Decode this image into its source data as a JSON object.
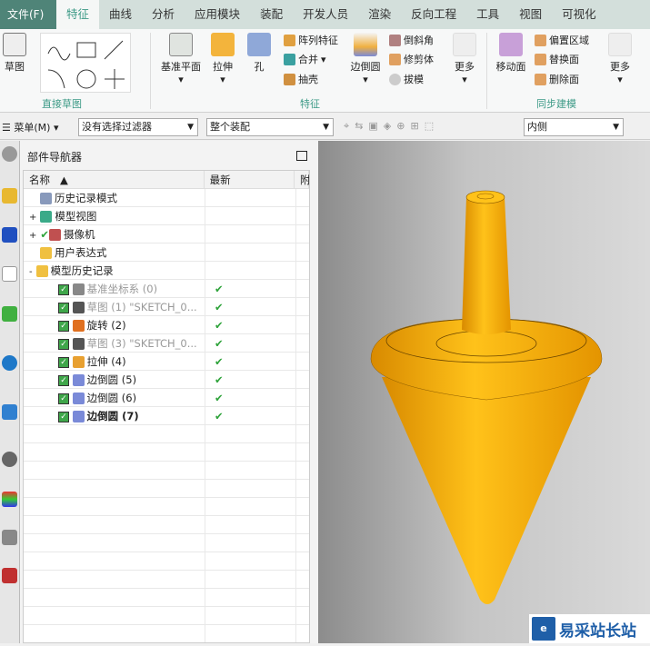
{
  "menubar": {
    "file": "文件(F)",
    "tabs": [
      "特征",
      "曲线",
      "分析",
      "应用模块",
      "装配",
      "开发人员",
      "渲染",
      "反向工程",
      "工具",
      "视图",
      "可视化"
    ],
    "active": "特征"
  },
  "ribbon": {
    "sketch": "草图",
    "direct_sketch_group": "直接草图",
    "datum_plane": "基准平面",
    "extrude": "拉伸",
    "hole": "孔",
    "pattern": "阵列特征",
    "unite": "合并",
    "shell": "抽壳",
    "edge_blend": "边倒圆",
    "chamfer": "倒斜角",
    "trim_body": "修剪体",
    "draft": "拔模",
    "more1": "更多",
    "feature_group": "特征",
    "move_face": "移动面",
    "offset_region": "偏置区域",
    "replace_face": "替换面",
    "delete_face": "删除面",
    "more2": "更多",
    "sync_group": "同步建模"
  },
  "toolbar": {
    "menu": "菜单(M)",
    "filter": "没有选择过滤器",
    "scope": "整个装配",
    "snap": "内侧"
  },
  "navigator": {
    "title": "部件导航器",
    "columns": [
      "名称",
      "最新",
      "附"
    ],
    "rows": [
      {
        "label": "历史记录模式",
        "icon": "clock-icon",
        "expander": "",
        "check": false,
        "latest": "",
        "style": "normal"
      },
      {
        "label": "模型视图",
        "icon": "model-view-icon",
        "expander": "+",
        "check": false,
        "latest": "",
        "style": "normal"
      },
      {
        "label": "摄像机",
        "icon": "camera-icon",
        "expander": "+",
        "check": false,
        "latest": "",
        "style": "normal",
        "green_tick": true
      },
      {
        "label": "用户表达式",
        "icon": "folder-icon",
        "expander": "",
        "check": false,
        "latest": "",
        "style": "normal"
      },
      {
        "label": "模型历史记录",
        "icon": "folder-open-icon",
        "expander": "-",
        "check": false,
        "latest": "",
        "style": "normal"
      },
      {
        "label": "基准坐标系 (0)",
        "icon": "datum-csys-icon",
        "check": true,
        "latest": "✔",
        "style": "gray"
      },
      {
        "label": "草图 (1) \"SKETCH_0...",
        "icon": "sketch-icon",
        "check": true,
        "latest": "✔",
        "style": "gray"
      },
      {
        "label": "旋转 (2)",
        "icon": "revolve-icon",
        "check": true,
        "latest": "✔",
        "style": "normal"
      },
      {
        "label": "草图 (3) \"SKETCH_0...",
        "icon": "sketch-icon",
        "check": true,
        "latest": "✔",
        "style": "gray"
      },
      {
        "label": "拉伸 (4)",
        "icon": "extrude-icon",
        "check": true,
        "latest": "✔",
        "style": "normal"
      },
      {
        "label": "边倒圆 (5)",
        "icon": "edge-blend-icon",
        "check": true,
        "latest": "✔",
        "style": "normal"
      },
      {
        "label": "边倒圆 (6)",
        "icon": "edge-blend-icon",
        "check": true,
        "latest": "✔",
        "style": "normal"
      },
      {
        "label": "边倒圆 (7)",
        "icon": "edge-blend-icon",
        "check": true,
        "latest": "✔",
        "style": "bold"
      }
    ]
  },
  "watermark": {
    "text": "易采站长站"
  },
  "colors": {
    "accent": "#3c9a86",
    "model": "#f5a800",
    "check": "#2ea33a"
  }
}
